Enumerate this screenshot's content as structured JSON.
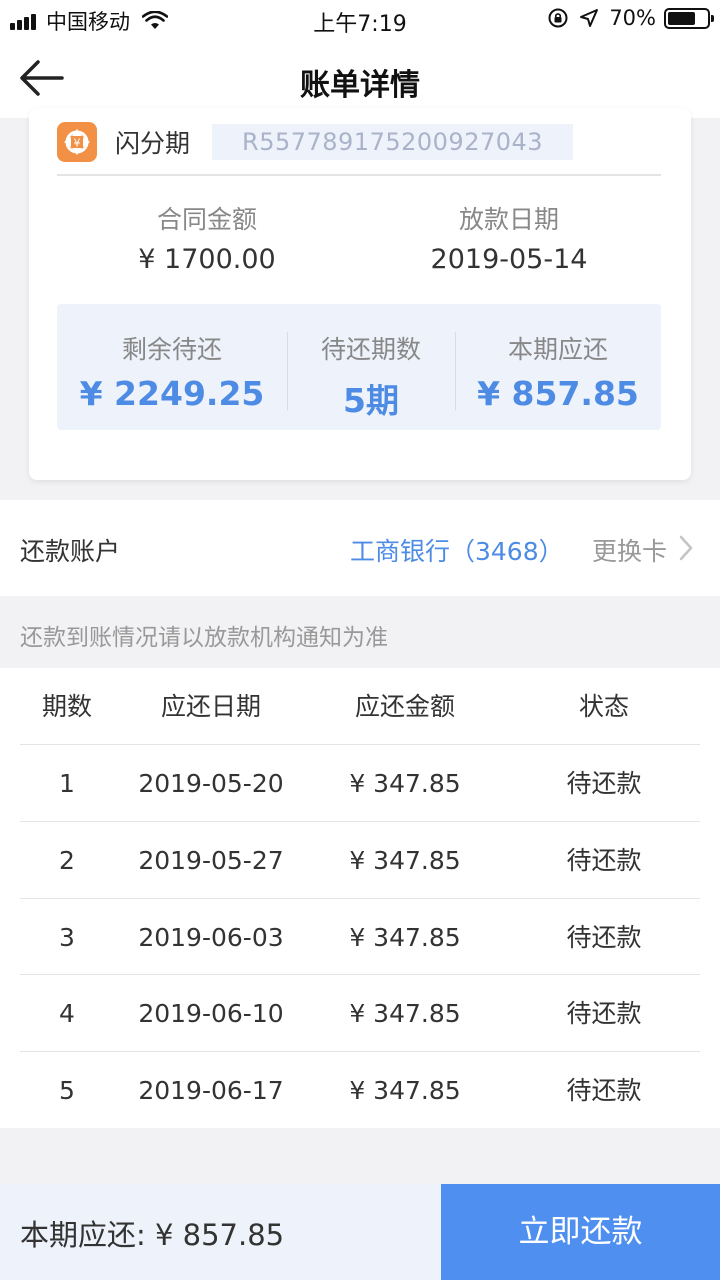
{
  "status_bar": {
    "carrier": "中国移动",
    "time": "上午7:19",
    "battery": "70%",
    "battery_level": 0.7
  },
  "nav": {
    "title": "账单详情"
  },
  "card": {
    "product_name": "闪分期",
    "contract_no": "R557789175200927043",
    "contract_amount_label": "合同金额",
    "contract_amount": "¥ 1700.00",
    "loan_date_label": "放款日期",
    "loan_date": "2019-05-14",
    "summary": {
      "remaining_label": "剩余待还",
      "remaining_value": "¥ 2249.25",
      "periods_label": "待还期数",
      "periods_value": "5期",
      "current_label": "本期应还",
      "current_value": "¥ 857.85"
    }
  },
  "account": {
    "label": "还款账户",
    "bank": "工商银行（3468）",
    "change": "更换卡"
  },
  "notice": "还款到账情况请以放款机构通知为准",
  "schedule": {
    "headers": [
      "期数",
      "应还日期",
      "应还金额",
      "状态"
    ],
    "rows": [
      [
        "1",
        "2019-05-20",
        "¥ 347.85",
        "待还款"
      ],
      [
        "2",
        "2019-05-27",
        "¥ 347.85",
        "待还款"
      ],
      [
        "3",
        "2019-06-03",
        "¥ 347.85",
        "待还款"
      ],
      [
        "4",
        "2019-06-10",
        "¥ 347.85",
        "待还款"
      ],
      [
        "5",
        "2019-06-17",
        "¥ 347.85",
        "待还款"
      ]
    ]
  },
  "bottom": {
    "amount": "本期应还: ¥ 857.85",
    "pay_button": "立即还款"
  },
  "colors": {
    "accent": "#4d8be4",
    "button": "#4e8ff0",
    "logo": "#f29146"
  }
}
